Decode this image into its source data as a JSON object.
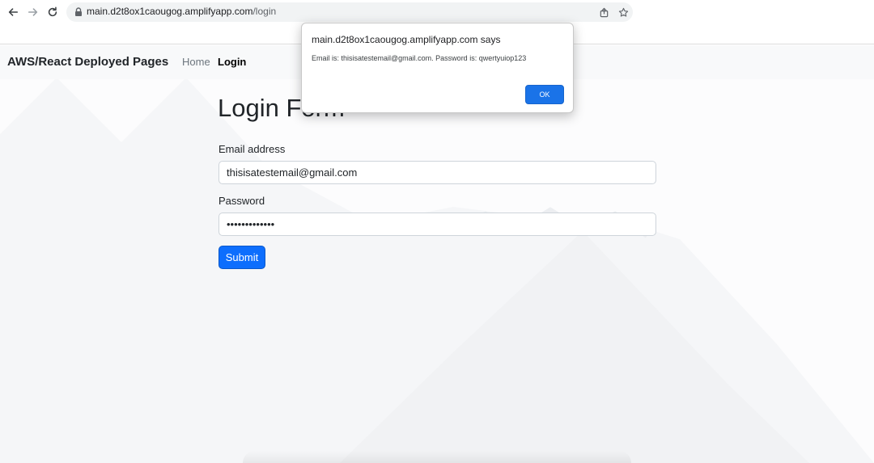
{
  "browser": {
    "url_host": "main.d2t8ox1caougog.amplifyapp.com",
    "url_path": "/login",
    "icons": [
      "back-arrow-icon",
      "forward-arrow-icon",
      "reload-icon",
      "lock-icon",
      "share-icon",
      "star-icon"
    ]
  },
  "navbar": {
    "brand": "AWS/React Deployed Pages",
    "links": [
      {
        "label": "Home",
        "active": false
      },
      {
        "label": "Login",
        "active": true
      }
    ]
  },
  "form": {
    "title": "Login Form",
    "email_label": "Email address",
    "email_value": "thisisatestemail@gmail.com",
    "password_label": "Password",
    "password_masked": "•••••••••••••",
    "submit_label": "Submit"
  },
  "dialog": {
    "title": "main.d2t8ox1caougog.amplifyapp.com says",
    "message": "Email is: thisisatestemail@gmail.com. Password is: qwertyuiop123",
    "ok_label": "OK"
  },
  "colors": {
    "primary": "#0d6efd",
    "dialog_button": "#1a73e8",
    "navbar_bg": "#f8f9fa"
  }
}
